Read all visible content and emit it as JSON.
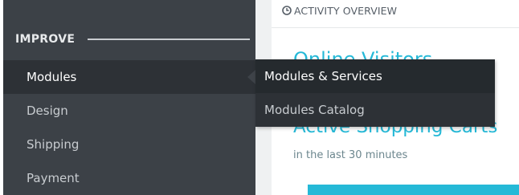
{
  "sidebar": {
    "section_label": "IMPROVE",
    "items": [
      {
        "label": "Modules",
        "active": true
      },
      {
        "label": "Design",
        "active": false
      },
      {
        "label": "Shipping",
        "active": false
      },
      {
        "label": "Payment",
        "active": false
      }
    ]
  },
  "submenu": {
    "items": [
      {
        "label": "Modules & Services",
        "active": true
      },
      {
        "label": "Modules Catalog",
        "active": false
      }
    ]
  },
  "main": {
    "panel_title": "ACTIVITY OVERVIEW",
    "panel_icon": "clock-icon",
    "online_visitors_label": "Online Visitors",
    "active_carts_label": "Active Shopping Carts",
    "active_carts_subtitle": "in the last 30 minutes"
  },
  "colors": {
    "sidebar_bg": "#3c4147",
    "sidebar_active_bg": "#2d3136",
    "accent": "#25b9d7",
    "main_bg": "#eff1f2"
  }
}
